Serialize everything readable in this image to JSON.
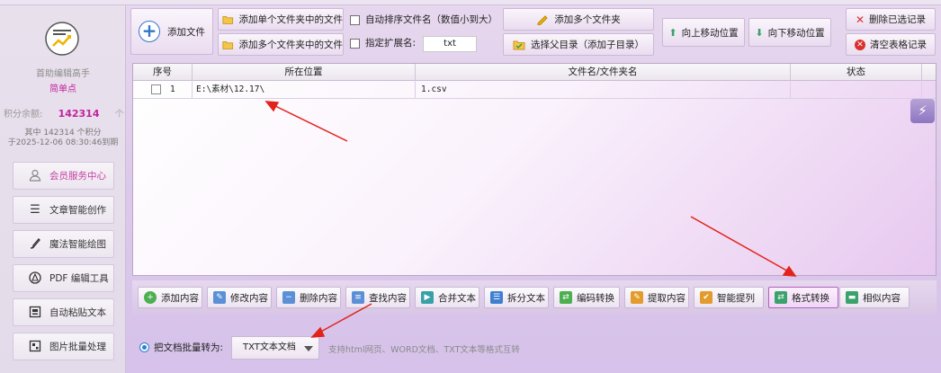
{
  "sidebar": {
    "brand": "首助编辑高手",
    "sub": "简单点",
    "points_label": "积分余额:",
    "points_value": "142314",
    "points_unit": "个",
    "points_detail_1": "其中 142314 个积分",
    "points_detail_2": "于2025-12-06 08:30:46到期",
    "items": [
      {
        "label": "会员服务中心",
        "icon": "person-icon"
      },
      {
        "label": "文章智能创作",
        "icon": "list-icon"
      },
      {
        "label": "魔法智能绘图",
        "icon": "brush-icon"
      },
      {
        "label": "PDF 编辑工具",
        "icon": "pdf-icon"
      },
      {
        "label": "自动粘贴文本",
        "icon": "paste-icon"
      },
      {
        "label": "图片批量处理",
        "icon": "image-icon"
      }
    ]
  },
  "toolbar": {
    "add_file": "添加文件",
    "add_single_folder": "添加单个文件夹中的文件",
    "add_multi_folder_files": "添加多个文件夹中的文件",
    "auto_sort": "自动排序文件名（数值小到大）",
    "specify_ext": "指定扩展名:",
    "ext_value": "txt",
    "add_multi_folders": "添加多个文件夹",
    "select_parent": "选择父目录（添加子目录）",
    "move_up": "向上移动位置",
    "move_down": "向下移动位置",
    "delete_selected": "删除已选记录",
    "clear_table": "清空表格记录"
  },
  "table": {
    "headers": [
      "序号",
      "所在位置",
      "文件名/文件夹名",
      "状态"
    ],
    "rows": [
      {
        "index": "1",
        "location": "E:\\素材\\12.17\\",
        "name": "1.csv",
        "status": ""
      }
    ]
  },
  "functions": {
    "items": [
      {
        "label": "添加内容",
        "color": "#4caf50"
      },
      {
        "label": "修改内容",
        "color": "#5b8fd6"
      },
      {
        "label": "删除内容",
        "color": "#5b8fd6"
      },
      {
        "label": "查找内容",
        "color": "#5b8fd6"
      },
      {
        "label": "合并文本",
        "color": "#3aa0a8"
      },
      {
        "label": "拆分文本",
        "color": "#3f7fd0"
      },
      {
        "label": "编码转换",
        "color": "#4caf50"
      },
      {
        "label": "提取内容",
        "color": "#e39b2b"
      },
      {
        "label": "智能提列",
        "color": "#e39b2b"
      },
      {
        "label": "格式转换",
        "color": "#3aa36b"
      },
      {
        "label": "相似内容",
        "color": "#3aa36b"
      }
    ],
    "active": "格式转换"
  },
  "options": {
    "convert_label": "把文档批量转为:",
    "convert_value": "TXT文本文档",
    "hint": "支持html网页、WORD文档、TXT文本等格式互转"
  }
}
